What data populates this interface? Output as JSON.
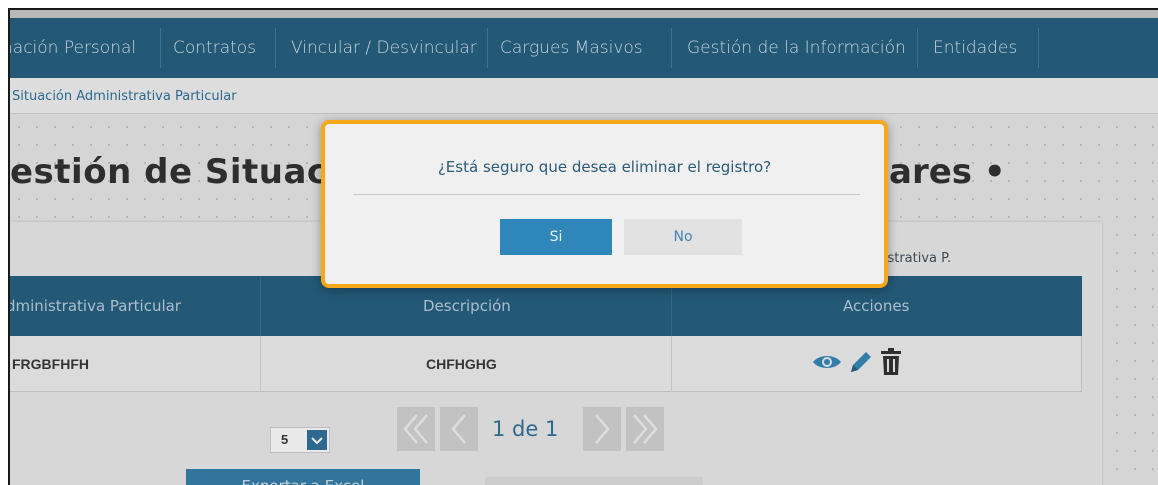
{
  "nav": {
    "items": [
      {
        "label": "nación Personal"
      },
      {
        "label": "Contratos"
      },
      {
        "label": "Vincular / Desvincular"
      },
      {
        "label": "Cargues Masivos"
      },
      {
        "label": "Gestión de la Información"
      },
      {
        "label": "Entidades"
      }
    ]
  },
  "breadcrumb": {
    "current": "Situación Administrativa Particular"
  },
  "page": {
    "title_left": "estión de Situaci",
    "title_right": "ares •"
  },
  "panel": {
    "label": "inistrativa P."
  },
  "table": {
    "headers": [
      "dministrativa Particular",
      "Descripción",
      "Acciones"
    ],
    "rows": [
      {
        "name": "FRGBFHFH",
        "description": "CHFHGHG"
      }
    ]
  },
  "actions": {
    "icons": [
      "eye-icon",
      "pencil-icon",
      "trash-icon"
    ]
  },
  "pagination": {
    "page_size": "5",
    "page_text": "1 de 1"
  },
  "export": {
    "label": "Exportar a Excel"
  },
  "modal": {
    "message": "¿Está seguro que desea eliminar el registro?",
    "yes_label": "Si",
    "no_label": "No"
  },
  "colors": {
    "nav_bg": "#1e5a7e",
    "accent": "#2f86b8",
    "modal_border": "#f5a81c"
  }
}
